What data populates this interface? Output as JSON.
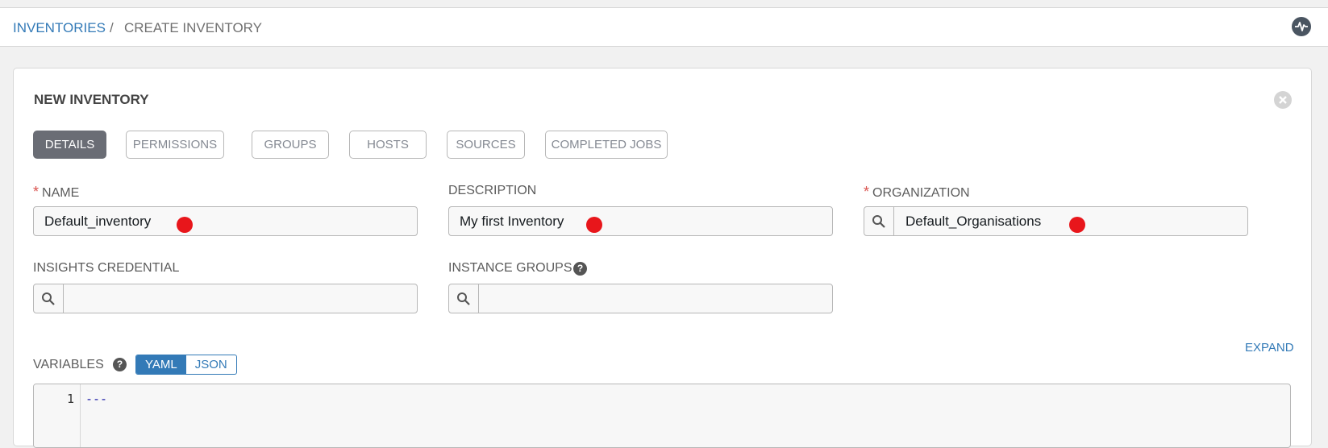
{
  "breadcrumb": {
    "parent": "INVENTORIES",
    "separator": "/",
    "current": "CREATE INVENTORY"
  },
  "header": {
    "activity_icon": "activity-stream-icon"
  },
  "panel": {
    "title": "NEW INVENTORY",
    "close_icon": "close-icon",
    "tabs": [
      {
        "label": "DETAILS",
        "active": true
      },
      {
        "label": "PERMISSIONS",
        "active": false
      },
      {
        "label": "GROUPS",
        "active": false
      },
      {
        "label": "HOSTS",
        "active": false
      },
      {
        "label": "SOURCES",
        "active": false
      },
      {
        "label": "COMPLETED JOBS",
        "active": false
      }
    ]
  },
  "form": {
    "required_mark": "*",
    "name": {
      "label": "NAME",
      "value": "Default_inventory",
      "required": true
    },
    "description": {
      "label": "DESCRIPTION",
      "value": "My first Inventory"
    },
    "organization": {
      "label": "ORGANIZATION",
      "value": "Default_Organisations",
      "required": true
    },
    "insights_credential": {
      "label": "INSIGHTS CREDENTIAL",
      "value": ""
    },
    "instance_groups": {
      "label": "INSTANCE GROUPS",
      "value": "",
      "help": "?"
    },
    "variables": {
      "label": "VARIABLES",
      "help": "?",
      "mode_yaml": "YAML",
      "mode_json": "JSON",
      "active_mode": "YAML",
      "expand": "EXPAND",
      "line_numbers": [
        "1"
      ],
      "content": "---"
    }
  },
  "colors": {
    "accent": "#337ab7",
    "active_tab": "#6a6d75",
    "required": "#d9534f",
    "annotation_marker": "#e8161b"
  }
}
